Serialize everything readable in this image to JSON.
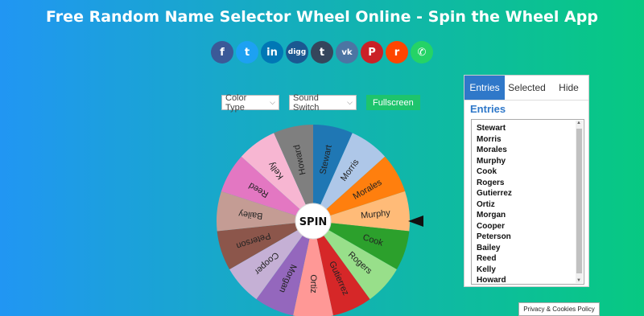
{
  "page": {
    "title": "Free Random Name Selector Wheel Online - Spin the Wheel App"
  },
  "social": [
    {
      "icon": "facebook-icon",
      "glyph": "f",
      "color": "#3b5998"
    },
    {
      "icon": "twitter-icon",
      "glyph": "t",
      "color": "#1da1f2"
    },
    {
      "icon": "linkedin-icon",
      "glyph": "in",
      "color": "#0077b5"
    },
    {
      "icon": "digg-icon",
      "glyph": "digg",
      "color": "#1b5891"
    },
    {
      "icon": "tumblr-icon",
      "glyph": "t",
      "color": "#35465c"
    },
    {
      "icon": "vk-icon",
      "glyph": "vk",
      "color": "#4c75a3"
    },
    {
      "icon": "pinterest-icon",
      "glyph": "P",
      "color": "#cb2027"
    },
    {
      "icon": "reddit-icon",
      "glyph": "r",
      "color": "#ff4500"
    },
    {
      "icon": "whatsapp-icon",
      "glyph": "✆",
      "color": "#25d366"
    }
  ],
  "controls": {
    "color_type": "Color Type",
    "sound_switch": "Sound Switch",
    "fullscreen": "Fullscreen"
  },
  "wheel": {
    "center_label": "SPIN",
    "segments": [
      {
        "name": "Stewart",
        "color": "#1f77b4"
      },
      {
        "name": "Morris",
        "color": "#aec7e8"
      },
      {
        "name": "Morales",
        "color": "#ff7f0e"
      },
      {
        "name": "Murphy",
        "color": "#ffbb78"
      },
      {
        "name": "Cook",
        "color": "#2ca02c"
      },
      {
        "name": "Rogers",
        "color": "#98df8a"
      },
      {
        "name": "Gutierrez",
        "color": "#d62728"
      },
      {
        "name": "Ortiz",
        "color": "#ff9896"
      },
      {
        "name": "Morgan",
        "color": "#9467bd"
      },
      {
        "name": "Cooper",
        "color": "#c5b0d5"
      },
      {
        "name": "Peterson",
        "color": "#8c564b"
      },
      {
        "name": "Bailey",
        "color": "#c49c94"
      },
      {
        "name": "Reed",
        "color": "#e377c2"
      },
      {
        "name": "Kelly",
        "color": "#f7b6d2"
      },
      {
        "name": "Howard",
        "color": "#7f7f7f"
      }
    ]
  },
  "panel": {
    "tabs": [
      "Entries",
      "Selected",
      "Hide"
    ],
    "heading": "Entries",
    "entries": [
      "Stewart",
      "Morris",
      "Morales",
      "Murphy",
      "Cook",
      "Rogers",
      "Gutierrez",
      "Ortiz",
      "Morgan",
      "Cooper",
      "Peterson",
      "Bailey",
      "Reed",
      "Kelly",
      "Howard"
    ]
  },
  "footer": {
    "privacy": "Privacy & Cookies Policy"
  }
}
